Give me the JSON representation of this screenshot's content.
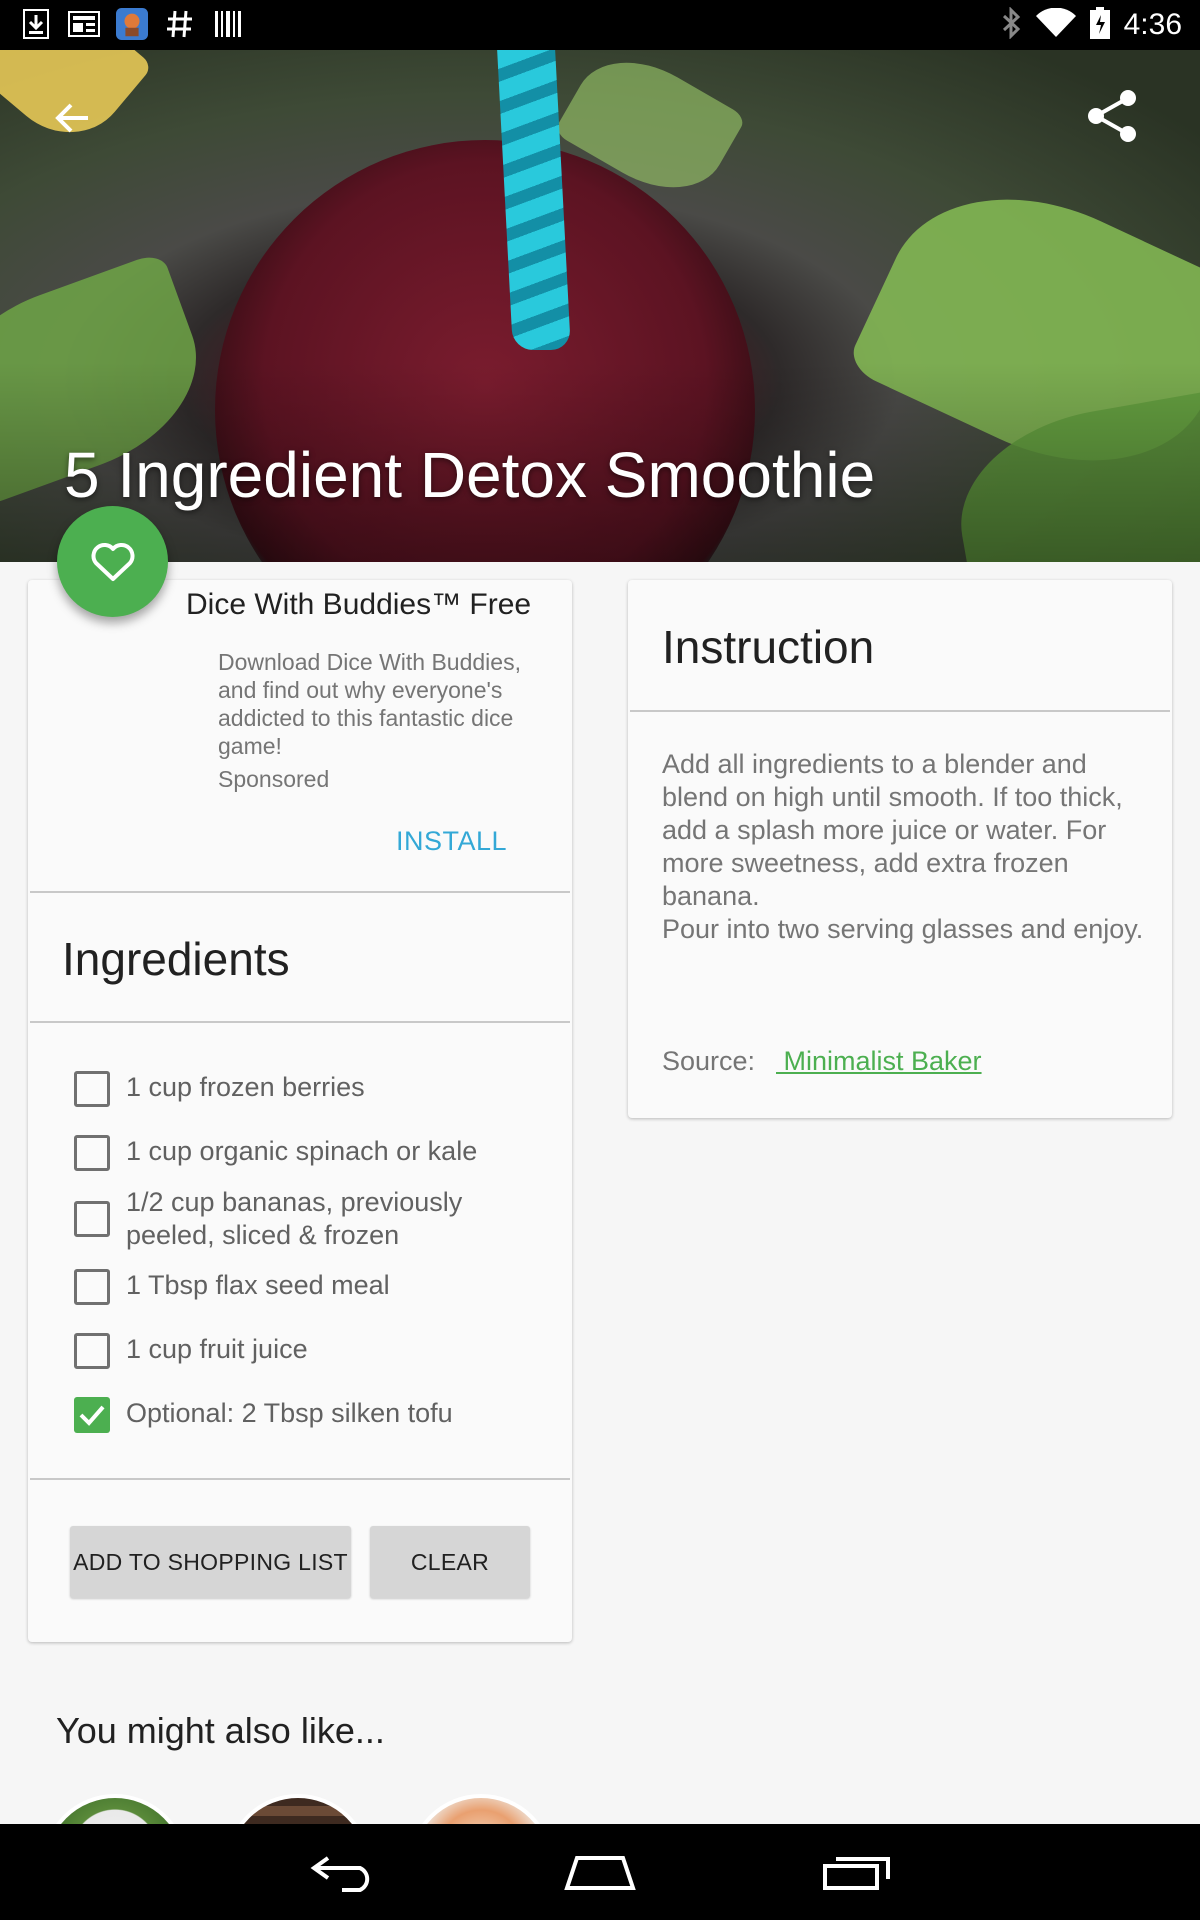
{
  "status_bar": {
    "time": "4:36",
    "left_icons": [
      "download-icon",
      "news-icon",
      "app-icon",
      "hash-icon",
      "barcode-icon"
    ],
    "right_icons": [
      "bluetooth-icon",
      "wifi-icon",
      "battery-icon"
    ]
  },
  "hero": {
    "title": "5 Ingredient Detox Smoothie",
    "back_icon": "arrow-back-icon",
    "share_icon": "share-icon"
  },
  "favorite": {
    "icon": "heart-outline-icon",
    "color": "#4caf50"
  },
  "ad": {
    "title": "Dice With Buddies™ Free",
    "body": "Download Dice With Buddies, and find out why everyone's addicted to this fantastic dice game!",
    "sponsored": "Sponsored",
    "install": "INSTALL",
    "install_color": "#33a8d6"
  },
  "ingredients": {
    "title": "Ingredients",
    "items": [
      {
        "label": "1 cup frozen berries",
        "checked": false
      },
      {
        "label": "1 cup organic spinach or kale",
        "checked": false
      },
      {
        "label": "1/2 cup bananas, previously peeled, sliced & frozen",
        "checked": false
      },
      {
        "label": "1 Tbsp flax seed meal",
        "checked": false
      },
      {
        "label": "1 cup fruit juice",
        "checked": false
      },
      {
        "label": "Optional: 2 Tbsp silken tofu",
        "checked": true
      }
    ],
    "add_button": "ADD TO SHOPPING LIST",
    "clear_button": "CLEAR"
  },
  "instruction": {
    "title": "Instruction",
    "body_lines": [
      "Add all ingredients to a blender and blend on high until smooth. If too thick, add a splash more juice or water. For more sweetness, add extra frozen banana.",
      "Pour into two serving glasses and enjoy."
    ],
    "source_label": "Source:",
    "source_link": " Minimalist Baker",
    "link_color": "#4caf50"
  },
  "also_like": {
    "title": "You might also like..."
  },
  "nav_bar": {
    "icons": [
      "back-nav-icon",
      "home-nav-icon",
      "recents-nav-icon"
    ]
  }
}
